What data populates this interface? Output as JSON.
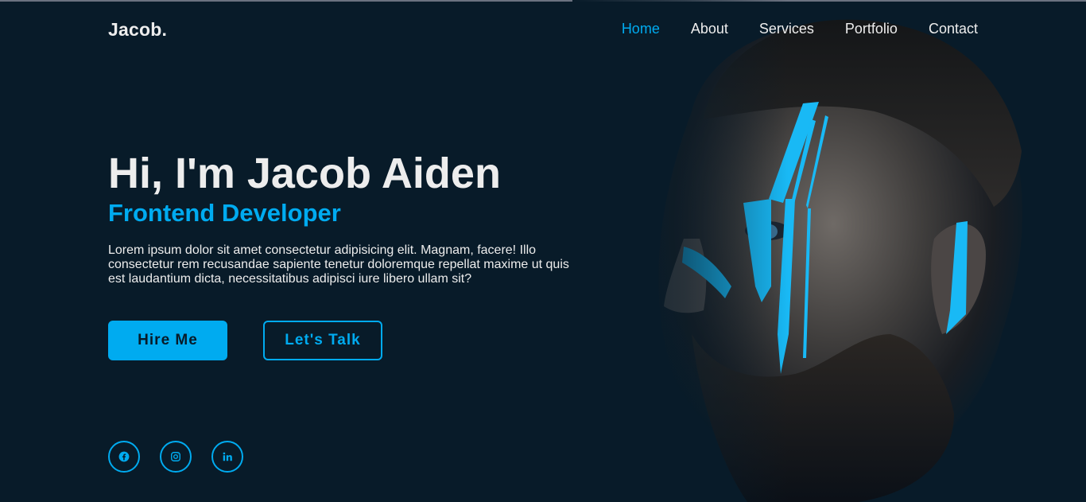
{
  "brand": {
    "logo": "Jacob."
  },
  "nav": {
    "items": [
      {
        "label": "Home",
        "active": true
      },
      {
        "label": "About",
        "active": false
      },
      {
        "label": "Services",
        "active": false
      },
      {
        "label": "Portfolio",
        "active": false
      },
      {
        "label": "Contact",
        "active": false
      }
    ]
  },
  "hero": {
    "title": "Hi, I'm Jacob Aiden",
    "subtitle": "Frontend Developer",
    "description": "Lorem ipsum dolor sit amet consectetur adipisicing elit. Magnam, facere! Illo consectetur rem recusandae sapiente tenetur doloremque repellat maxime ut quis est laudantium dicta, necessitatibus adipisci iure libero ullam sit?",
    "primary_button": "Hire Me",
    "secondary_button": "Let's Talk"
  },
  "social": {
    "icons": [
      "facebook-icon",
      "instagram-icon",
      "linkedin-icon"
    ]
  },
  "colors": {
    "background": "#081b29",
    "accent": "#00abf0",
    "text": "#ededed"
  }
}
